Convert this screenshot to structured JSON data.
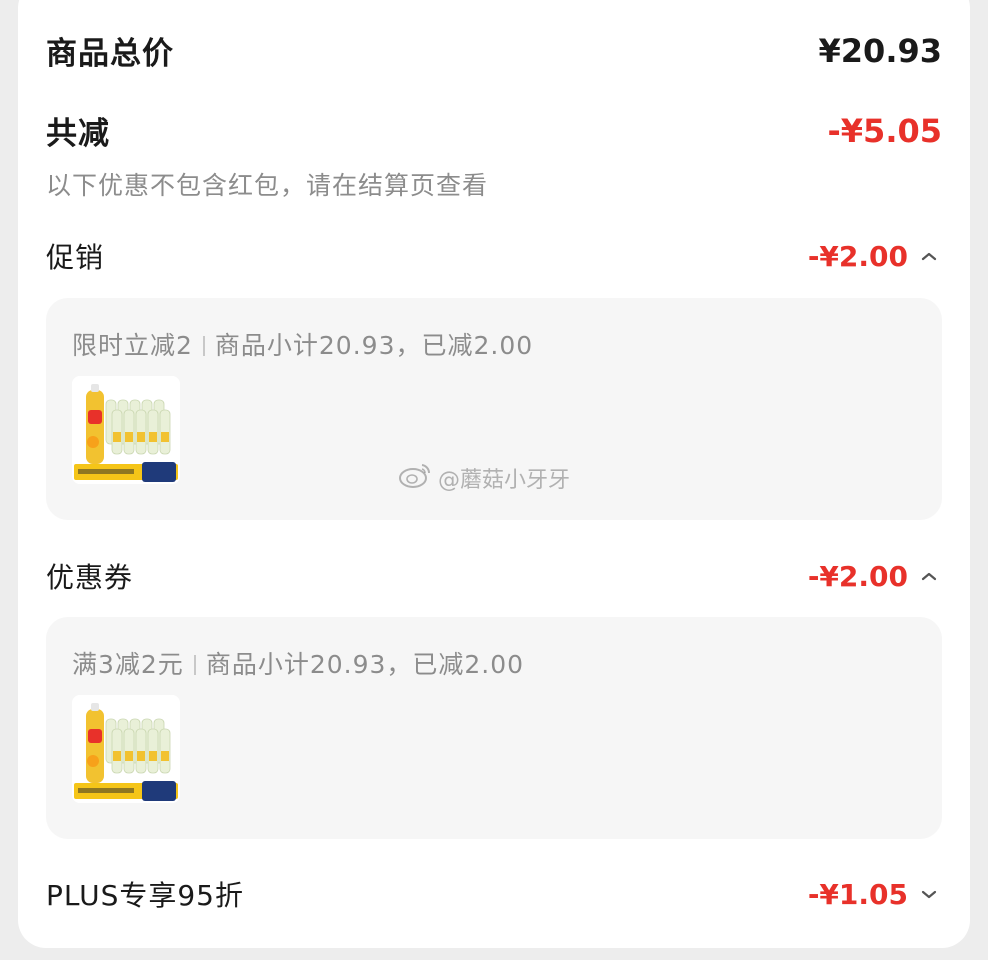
{
  "summary": {
    "total_label": "商品总价",
    "total_value": "¥20.93",
    "discount_label": "共减",
    "discount_value": "-¥5.05",
    "note": "以下优惠不包含红包，请在结算页查看"
  },
  "sections": [
    {
      "title": "促销",
      "amount": "-¥2.00",
      "expanded": true,
      "detail_name": "限时立减2",
      "detail_info": "商品小计20.93，已减2.00"
    },
    {
      "title": "优惠券",
      "amount": "-¥2.00",
      "expanded": true,
      "detail_name": "满3减2元",
      "detail_info": "商品小计20.93，已减2.00"
    },
    {
      "title": "PLUS专享95折",
      "amount": "-¥1.05",
      "expanded": false
    }
  ],
  "watermark": "@蘑菇小牙牙",
  "colors": {
    "accent_red": "#e8312a",
    "text_dark": "#1a1a1a",
    "text_muted": "#8c8c8c",
    "panel_bg": "#f6f6f6"
  },
  "icons": {
    "expand_open": "chevron-up-icon",
    "expand_closed": "chevron-down-icon",
    "watermark_logo": "weibo-icon"
  }
}
